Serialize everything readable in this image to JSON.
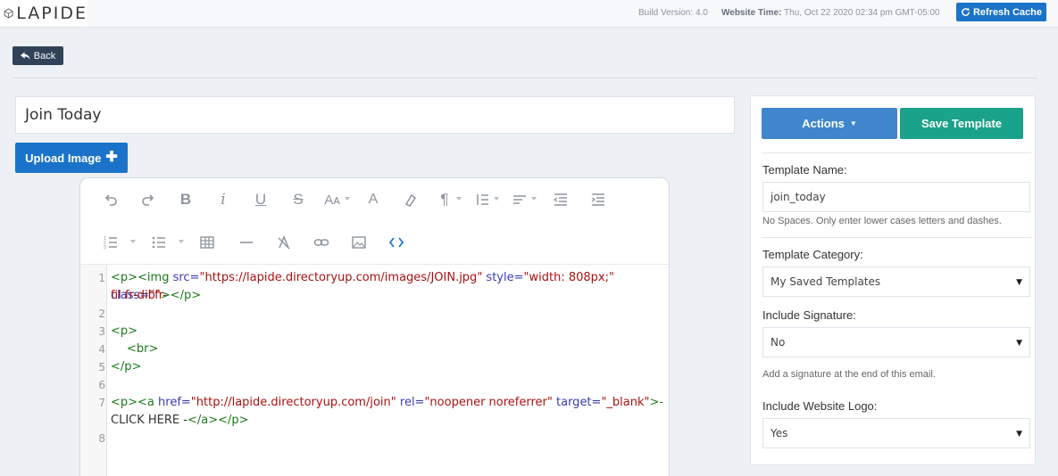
{
  "topbar": {
    "logo_text": "LAPIDE",
    "build_label": "Build Version:",
    "build_value": "4.0",
    "time_label": "Website Time:",
    "time_value": "Thu, Oct 22 2020 02:34 pm GMT-05:00",
    "refresh_label": "Refresh Cache"
  },
  "back_label": "Back",
  "title_value": "Join Today",
  "upload_label": "Upload Image",
  "editor": {
    "lines": [
      {
        "num": "1"
      },
      {
        "num": "2"
      },
      {
        "num": "3"
      },
      {
        "num": "4"
      },
      {
        "num": "5"
      },
      {
        "num": "6"
      },
      {
        "num": "7"
      },
      {
        "num": "8"
      }
    ],
    "code": {
      "l1_a": "<p><img ",
      "l1_attr1": "src=",
      "l1_str1": "\"https://lapide.directoryup.com/images/JOIN.jpg\"",
      "l1_attr2": " style=",
      "l1_str2": "\"width: 808px;\"",
      "l1_attr3": " class=",
      "l1_str3a": "\"fr-",
      "l1_str3b": "fil fr-dib\"",
      "l1_end": "></p>",
      "l3": "<p>",
      "l4": "<br>",
      "l5": "</p>",
      "l7_a": "<p><a ",
      "l7_attr1": "href=",
      "l7_str1": "\"http://lapide.directoryup.com/join\"",
      "l7_attr2": " rel=",
      "l7_str2": "\"noopener noreferrer\"",
      "l7_attr3": " target=",
      "l7_str3": "\"_blank\"",
      "l7_gt": ">-",
      "l7_text": "CLICK HERE -",
      "l7_end": "</a></p>"
    }
  },
  "panel": {
    "actions_label": "Actions",
    "save_label": "Save Template",
    "name_label": "Template Name:",
    "name_value": "join_today",
    "name_hint": "No Spaces. Only enter lower cases letters and dashes.",
    "category_label": "Template Category:",
    "category_value": "My Saved Templates",
    "signature_label": "Include Signature:",
    "signature_value": "No",
    "signature_hint": "Add a signature at the end of this email.",
    "logo_label": "Include Website Logo:",
    "logo_value": "Yes"
  },
  "colors": {
    "primary": "#1a73c8",
    "accent_teal": "#1aa28a",
    "dark": "#2f4257"
  }
}
